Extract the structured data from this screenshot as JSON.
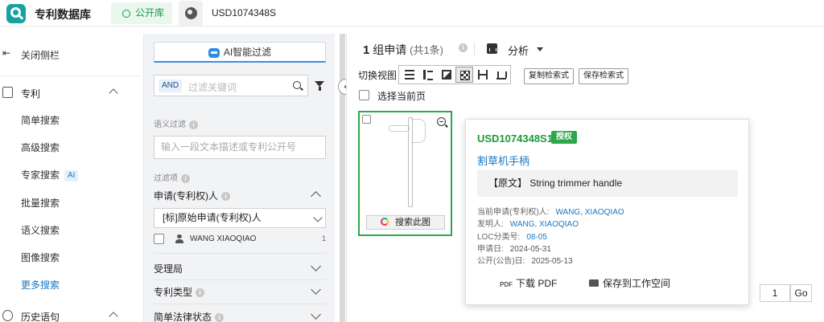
{
  "topbar": {
    "logo_text": "专利数据库",
    "library_tab": "公开库",
    "query": "USD1074348S"
  },
  "sidebar": {
    "close_label": "关闭侧栏",
    "patent_section": "专利",
    "items": [
      "简单搜索",
      "高级搜索",
      "专家搜索",
      "批量搜索",
      "语义搜索",
      "图像搜索",
      "更多搜索"
    ],
    "ai_badge": "AI",
    "history_section": "历史语句"
  },
  "filter_panel": {
    "ai_filter_label": "AI智能过滤",
    "and_tag": "AND",
    "keyword_placeholder": "过滤关键词",
    "semantic_label": "语义过滤",
    "semantic_placeholder": "输入一段文本描述或专利公开号",
    "filter_items_label": "过滤项",
    "applicant_group": "申请(专利权)人",
    "applicant_select": "[标]原始申请(专利权)人",
    "applicant_entry": {
      "name": "WANG XIAOQIAO",
      "count": "1"
    },
    "groups": [
      "受理局",
      "专利类型",
      "简单法律状态"
    ]
  },
  "main": {
    "result_count": "1",
    "result_unit": "组申请",
    "result_total": "(共1条)",
    "analysis_label": "分析",
    "view_label": "切换视图",
    "copy_query": "复制检索式",
    "save_query": "保存检索式",
    "select_page": "选择当前页",
    "search_image_button": "搜索此图",
    "card": {
      "patent_number": "USD1074348S1",
      "status_badge": "授权",
      "title": "割草机手柄",
      "abstract": "【原文】 String trimmer handle",
      "current_assignee_label": "当前申请(专利权)人:",
      "current_assignee": "WANG, XIAOQIAO",
      "inventor_label": "发明人:",
      "inventor": "WANG, XIAOQIAO",
      "loc_label": "LOC分类号:",
      "loc": "08-05",
      "app_date_label": "申请日:",
      "app_date": "2024-05-31",
      "pub_date_label": "公开(公告)日:",
      "pub_date": "2025-05-13",
      "download_pdf": "下载 PDF",
      "save_workspace": "保存到工作空间",
      "pdf_icon_text": "PDF"
    },
    "page_number": "1",
    "go_label": "Go"
  },
  "colors": {
    "accent_green": "#2ca84a",
    "link_blue": "#1a78c2",
    "logo_teal": "#16a2a0"
  }
}
